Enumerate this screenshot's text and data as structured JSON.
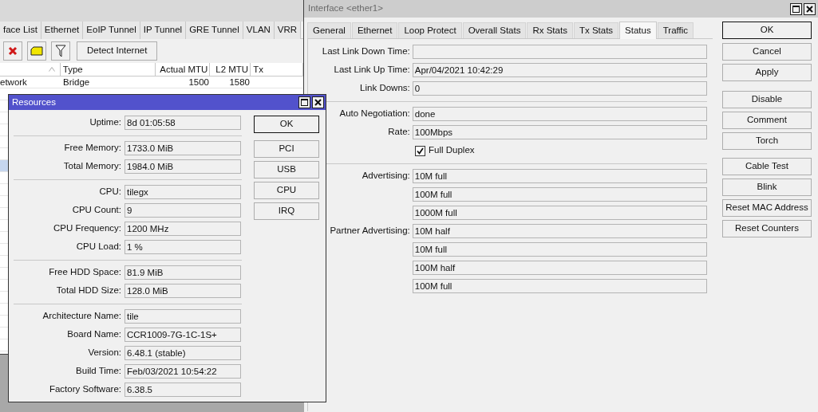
{
  "background_window": {
    "tabs": [
      {
        "label": "face List",
        "selected": false
      },
      {
        "label": "Ethernet",
        "selected": false
      },
      {
        "label": "EoIP Tunnel",
        "selected": false
      },
      {
        "label": "IP Tunnel",
        "selected": false
      },
      {
        "label": "GRE Tunnel",
        "selected": false
      },
      {
        "label": "VLAN",
        "selected": false
      },
      {
        "label": "VRR",
        "selected": false
      }
    ],
    "toolbar": {
      "button": "Detect Internet"
    },
    "table": {
      "columns": [
        {
          "label": "Type"
        },
        {
          "label": "Actual MTU"
        },
        {
          "label": "L2 MTU"
        },
        {
          "label": "Tx"
        }
      ],
      "rows": [
        {
          "name": "etwork",
          "type": "Bridge",
          "actual_mtu": "1500",
          "l2_mtu": "1580"
        },
        {
          "selected": true
        }
      ]
    }
  },
  "interface_window": {
    "title": "Interface <ether1>",
    "active": false,
    "tabs": [
      {
        "label": "General",
        "selected": false
      },
      {
        "label": "Ethernet",
        "selected": false
      },
      {
        "label": "Loop Protect",
        "selected": false
      },
      {
        "label": "Overall Stats",
        "selected": false
      },
      {
        "label": "Rx Stats",
        "selected": false
      },
      {
        "label": "Tx Stats",
        "selected": false
      },
      {
        "label": "Status",
        "selected": true
      },
      {
        "label": "Traffic",
        "selected": false
      }
    ],
    "groups": [
      [
        {
          "kind": "field",
          "label": "Last Link Down Time:"
        },
        {
          "kind": "field",
          "label": "Last Link Up Time:",
          "values": [
            "Apr/04/2021 10:42:29"
          ]
        },
        {
          "kind": "field",
          "label": "Link Downs:",
          "values": [
            "0"
          ]
        }
      ],
      [
        {
          "kind": "field",
          "label": "Auto Negotiation:",
          "values": [
            "done"
          ]
        },
        {
          "kind": "field",
          "label": "Rate:",
          "values": [
            "100Mbps"
          ]
        },
        {
          "kind": "checkbox",
          "label": "Full Duplex",
          "checked": true
        }
      ],
      [
        {
          "kind": "field",
          "label": "Advertising:",
          "values": [
            "10M full",
            "100M full",
            "1000M full"
          ]
        },
        {
          "kind": "field",
          "label": "Partner Advertising:",
          "values": [
            "10M half",
            "10M full",
            "100M half",
            "100M full"
          ]
        }
      ]
    ],
    "button_groups": [
      [
        {
          "label": "OK",
          "default": true
        }
      ],
      [
        {
          "label": "Cancel",
          "default": false
        },
        {
          "label": "Apply",
          "default": false
        }
      ],
      [
        {
          "label": "Disable",
          "default": false
        },
        {
          "label": "Comment",
          "default": false
        },
        {
          "label": "Torch",
          "default": false
        }
      ],
      [
        {
          "label": "Cable Test",
          "default": false
        },
        {
          "label": "Blink",
          "default": false
        },
        {
          "label": "Reset MAC Address",
          "default": false
        },
        {
          "label": "Reset Counters",
          "default": false
        }
      ]
    ]
  },
  "resources_window": {
    "title": "Resources",
    "active": true,
    "groups": [
      [
        {
          "label": "Uptime:",
          "value": "8d 01:05:58"
        }
      ],
      [
        {
          "label": "Free Memory:",
          "value": "1733.0 MiB"
        },
        {
          "label": "Total Memory:",
          "value": "1984.0 MiB"
        }
      ],
      [
        {
          "label": "CPU:",
          "value": "tilegx"
        },
        {
          "label": "CPU Count:",
          "value": "9"
        },
        {
          "label": "CPU Frequency:",
          "value": "1200 MHz"
        },
        {
          "label": "CPU Load:",
          "value": "1 %"
        }
      ],
      [
        {
          "label": "Free HDD Space:",
          "value": "81.9 MiB"
        },
        {
          "label": "Total HDD Size:",
          "value": "128.0 MiB"
        }
      ],
      [
        {
          "label": "Architecture Name:",
          "value": "tile"
        },
        {
          "label": "Board Name:",
          "value": "CCR1009-7G-1C-1S+"
        },
        {
          "label": "Version:",
          "value": "6.48.1 (stable)"
        },
        {
          "label": "Build Time:",
          "value": "Feb/03/2021 10:54:22"
        },
        {
          "label": "Factory Software:",
          "value": "6.38.5"
        }
      ]
    ],
    "button_groups": [
      [
        {
          "label": "OK",
          "default": true
        }
      ],
      [
        {
          "label": "PCI",
          "default": false
        },
        {
          "label": "USB",
          "default": false
        },
        {
          "label": "CPU",
          "default": false
        },
        {
          "label": "IRQ",
          "default": false
        }
      ]
    ]
  }
}
